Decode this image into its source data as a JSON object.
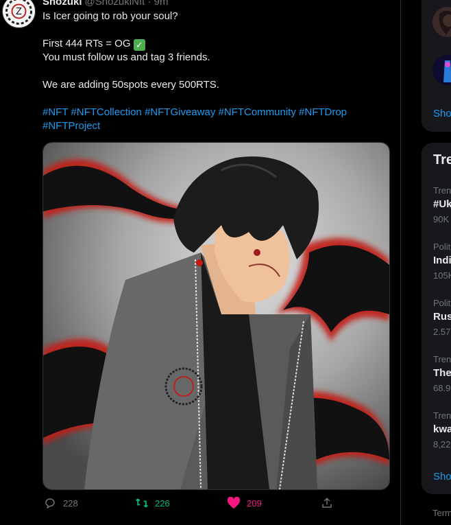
{
  "tweet": {
    "display_name": "Shozuki",
    "handle": "@ShozukiNft · 9m",
    "more_icon": "more-dots-icon",
    "lines": [
      "Is Icer going to rob your soul?",
      "First 444 RTs = OG",
      "You must follow us and tag 3 friends.",
      "We are adding 50spots every 500RTS."
    ],
    "check_emoji": "✓",
    "hashtags": [
      "#NFT",
      "#NFTCollection",
      "#NFTGiveaway",
      "#NFTCommunity",
      "#NFTDrop",
      "#NFTProject"
    ],
    "image_alt": "Anime illustration of dark-haired character in grey coat with red and black flames"
  },
  "actions": {
    "reply_count": "228",
    "retweet_count": "226",
    "like_count": "209",
    "retweet_color": "#00ba7c",
    "like_color": "#f91880"
  },
  "sidebar": {
    "show_more_1": "Sho",
    "trends_title": "Tre",
    "trends": [
      {
        "category": "Trenc",
        "name": "#Uk",
        "count": "90K"
      },
      {
        "category": "Polit",
        "name": "Indi",
        "count": "105K"
      },
      {
        "category": "Polit",
        "name": "Rus",
        "count": "2.57"
      },
      {
        "category": "Trenc",
        "name": "The",
        "count": "68.9"
      },
      {
        "category": "Trenc",
        "name": "kwa",
        "count": "8,22"
      }
    ],
    "show_more_2": "Sho",
    "footer": "Term"
  }
}
